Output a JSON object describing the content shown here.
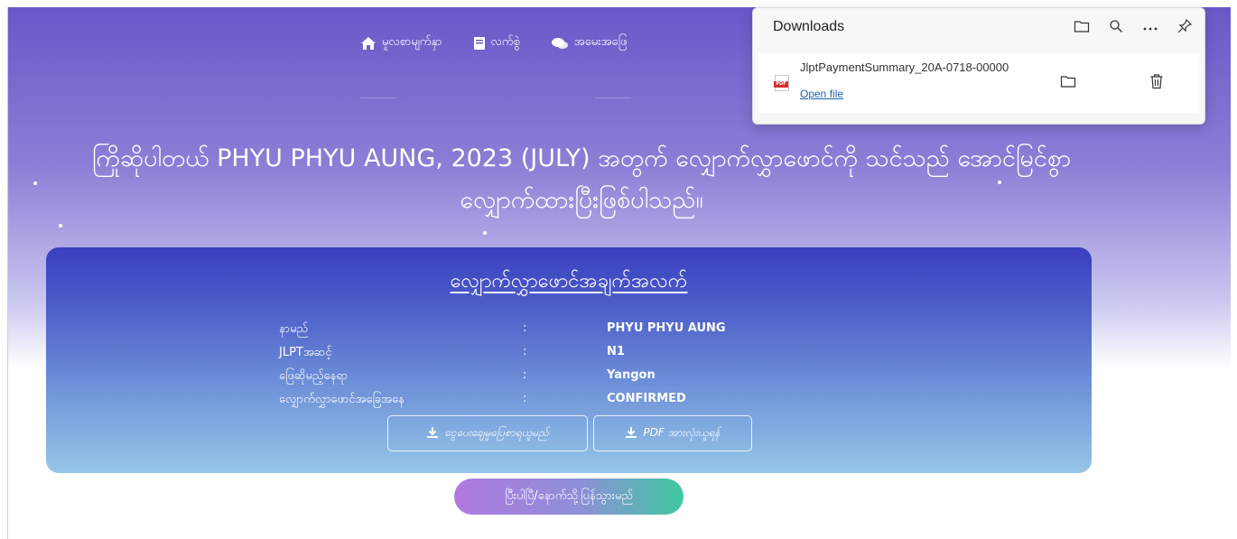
{
  "nav": {
    "items": [
      {
        "label": "မူလစာမျက်နှာ",
        "icon": "home-icon"
      },
      {
        "label": "လက်စွဲ",
        "icon": "book-icon"
      },
      {
        "label": "အမေးအဖြေ",
        "icon": "chat-icon"
      }
    ]
  },
  "headline": {
    "line1": "ကြိုဆိုပါတယ် PHYU PHYU AUNG, 2023 (JULY) အတွက် လျှောက်လွှာဖောင်ကို သင်သည် အောင်မြင်စွာ",
    "line2": "လျှောက်ထားပြီးဖြစ်ပါသည်။"
  },
  "card": {
    "title": "လျှောက်လွှာဖောင်အချက်အလက်",
    "rows": [
      {
        "label": "နာမည်",
        "colon": ":",
        "value": "PHYU PHYU AUNG"
      },
      {
        "label": "JLPTအဆင့်",
        "colon": ":",
        "value": "N1"
      },
      {
        "label": "ဖြေဆိုမည့်နေရာ",
        "colon": ":",
        "value": "Yangon"
      },
      {
        "label": "လျှောက်လွှာဖောင်အခြေအနေ",
        "colon": ":",
        "value": "CONFIRMED"
      }
    ],
    "btn_receipt": "ငွေပေးချေမှုပြေစာရယူမည်",
    "btn_pdf": "PDF အားလုံးယူရန်"
  },
  "back_button": "ပြီးပါပြီ/နောက်သို့ပြန်သွားမည်",
  "downloads": {
    "title": "Downloads",
    "file_name": "JlptPaymentSummary_20A-0718-00000",
    "open_file": "Open file",
    "file_type_badge": "PDF"
  },
  "colors": {
    "accent": "#6a57c8",
    "card_top": "#3a3fbf",
    "link": "#1a5fb4"
  }
}
